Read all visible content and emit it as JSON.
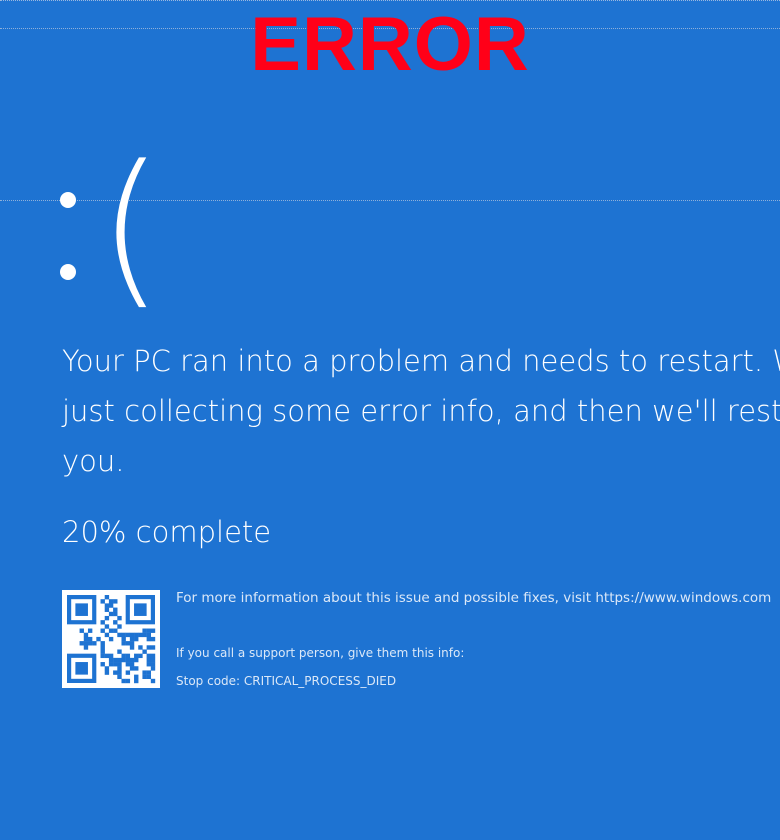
{
  "banner": {
    "text": "ERROR",
    "color": "#ff0018"
  },
  "screen": {
    "background_color": "#1e73d2",
    "sad_face": ":(",
    "message": "Your PC ran into a problem and needs to restart. W\njust collecting some error info, and then we'll resta\nyou.",
    "progress_text": "20% complete",
    "progress_percent": 20,
    "qr_code_icon": "qr-code",
    "info_line": "For more information about this issue and possible fixes, visit https://www.windows.com",
    "support_line": "If you call a support person, give them this info:",
    "stop_code_line": "Stop code: CRITICAL_PROCESS_DIED"
  }
}
